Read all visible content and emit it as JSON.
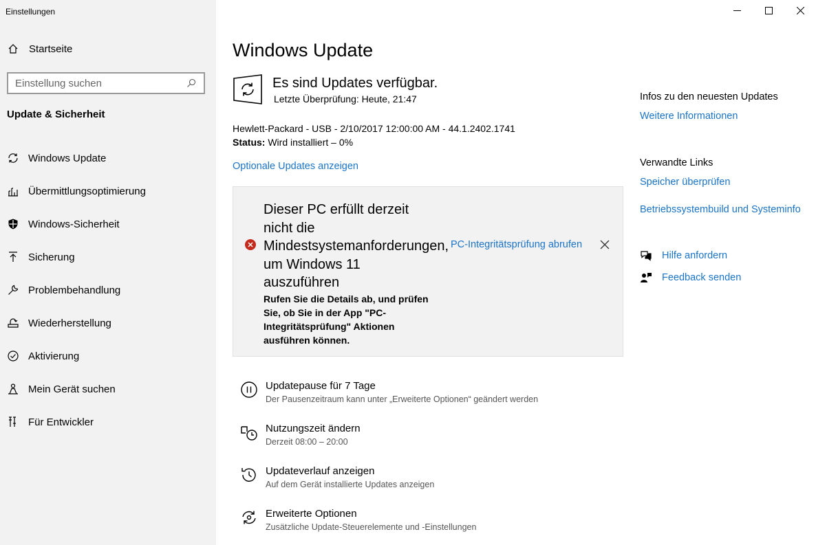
{
  "window": {
    "title": "Einstellungen",
    "controls": {
      "minimize": "minimize-icon",
      "maximize": "maximize-icon",
      "close": "close-icon"
    }
  },
  "sidebar": {
    "home_label": "Startseite",
    "search": {
      "placeholder": "Einstellung suchen"
    },
    "section_title": "Update & Sicherheit",
    "items": [
      {
        "label": "Windows Update",
        "icon": "refresh-icon"
      },
      {
        "label": "Übermittlungsoptimierung",
        "icon": "delivery-icon"
      },
      {
        "label": "Windows-Sicherheit",
        "icon": "shield-icon"
      },
      {
        "label": "Sicherung",
        "icon": "backup-arrow-icon"
      },
      {
        "label": "Problembehandlung",
        "icon": "wrench-icon"
      },
      {
        "label": "Wiederherstellung",
        "icon": "recovery-icon"
      },
      {
        "label": "Aktivierung",
        "icon": "check-circle-icon"
      },
      {
        "label": "Mein Gerät suchen",
        "icon": "person-location-icon"
      },
      {
        "label": "Für Entwickler",
        "icon": "developer-tools-icon"
      }
    ]
  },
  "main": {
    "title": "Windows Update",
    "status_title": "Es sind Updates verfügbar.",
    "last_check": "Letzte Überprüfung: Heute, 21:47",
    "update_name": "Hewlett-Packard - USB - 2/10/2017 12:00:00 AM - 44.1.2402.1741",
    "status_label": "Status:",
    "status_value": "Wird installiert – 0%",
    "optional_link": "Optionale Updates anzeigen",
    "banner": {
      "title": "Dieser PC erfüllt derzeit nicht die Mindestsystemanforderungen, um Windows 11 auszuführen",
      "body": "Rufen Sie die Details ab, und prüfen Sie, ob Sie in der App \"PC-Integritätsprüfung\" Aktionen ausführen können.",
      "link": "PC-Integritätsprüfung abrufen"
    },
    "options": [
      {
        "label": "Updatepause für 7 Tage",
        "sub": "Der Pausenzeitraum kann unter „Erweiterte Optionen“ geändert werden",
        "icon": "pause-icon"
      },
      {
        "label": "Nutzungszeit ändern",
        "sub": "Derzeit 08:00 – 20:00",
        "icon": "active-hours-icon"
      },
      {
        "label": "Updateverlauf anzeigen",
        "sub": "Auf dem Gerät installierte Updates anzeigen",
        "icon": "history-icon"
      },
      {
        "label": "Erweiterte Optionen",
        "sub": "Zusätzliche Update-Steuerelemente und -Einstellungen",
        "icon": "advanced-settings-icon"
      }
    ]
  },
  "right": {
    "latest_head": "Infos zu den neuesten Updates",
    "latest_link": "Weitere Informationen",
    "related_head": "Verwandte Links",
    "related_links": [
      "Speicher überprüfen",
      "Betriebssystembuild und Systeminfo"
    ],
    "help_label": "Hilfe anfordern",
    "feedback_label": "Feedback senden"
  },
  "colors": {
    "accent": "#1a73c7",
    "sidebar_bg": "#f2f2f2",
    "error": "#c42b1c"
  }
}
